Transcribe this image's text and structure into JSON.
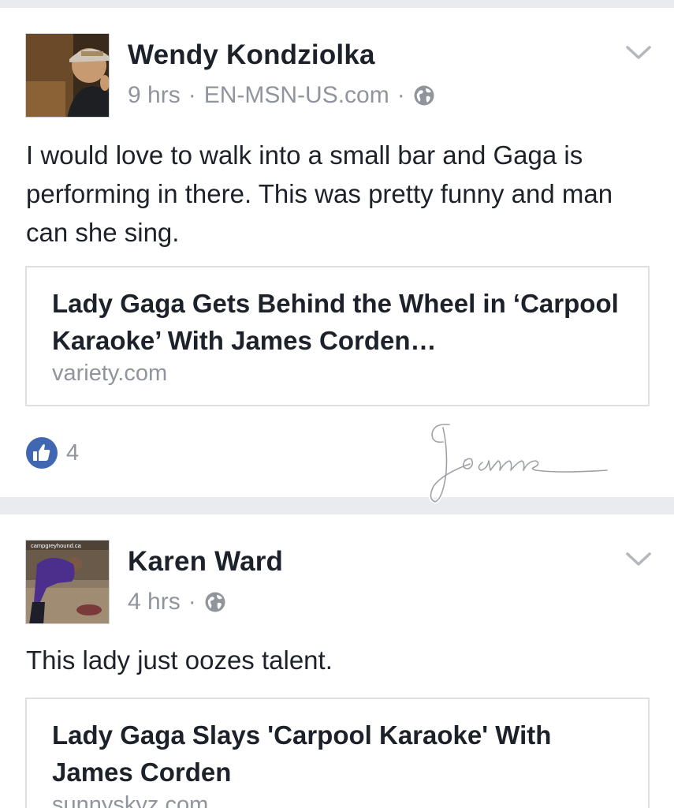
{
  "posts": [
    {
      "author": "Wendy Kondziolka",
      "time": "9 hrs",
      "via": "EN-MSN-US.com",
      "separator": "·",
      "text": "I would love to walk into a small bar and Gaga is performing in there.  This was pretty funny and man can she sing.",
      "link": {
        "title": "Lady Gaga Gets Behind the Wheel in ‘Carpool Karaoke’ With James Corden…",
        "domain": "variety.com"
      },
      "likes": "4",
      "signature": "Joanne"
    },
    {
      "author": "Karen Ward",
      "time": "4 hrs",
      "separator": "·",
      "avatar_watermark": "campgreyhound.ca",
      "text": "This lady just oozes talent.",
      "link": {
        "title": "Lady Gaga Slays 'Carpool Karaoke' With James Corden",
        "domain": "sunnyskyz.com"
      }
    }
  ],
  "icons": {
    "globe": "globe-icon",
    "chevron": "chevron-down-icon",
    "like": "thumbs-up-icon"
  },
  "colors": {
    "background": "#e9ebee",
    "like_blue": "#4267b2",
    "meta_gray": "#90949c",
    "text": "#1d2129"
  }
}
